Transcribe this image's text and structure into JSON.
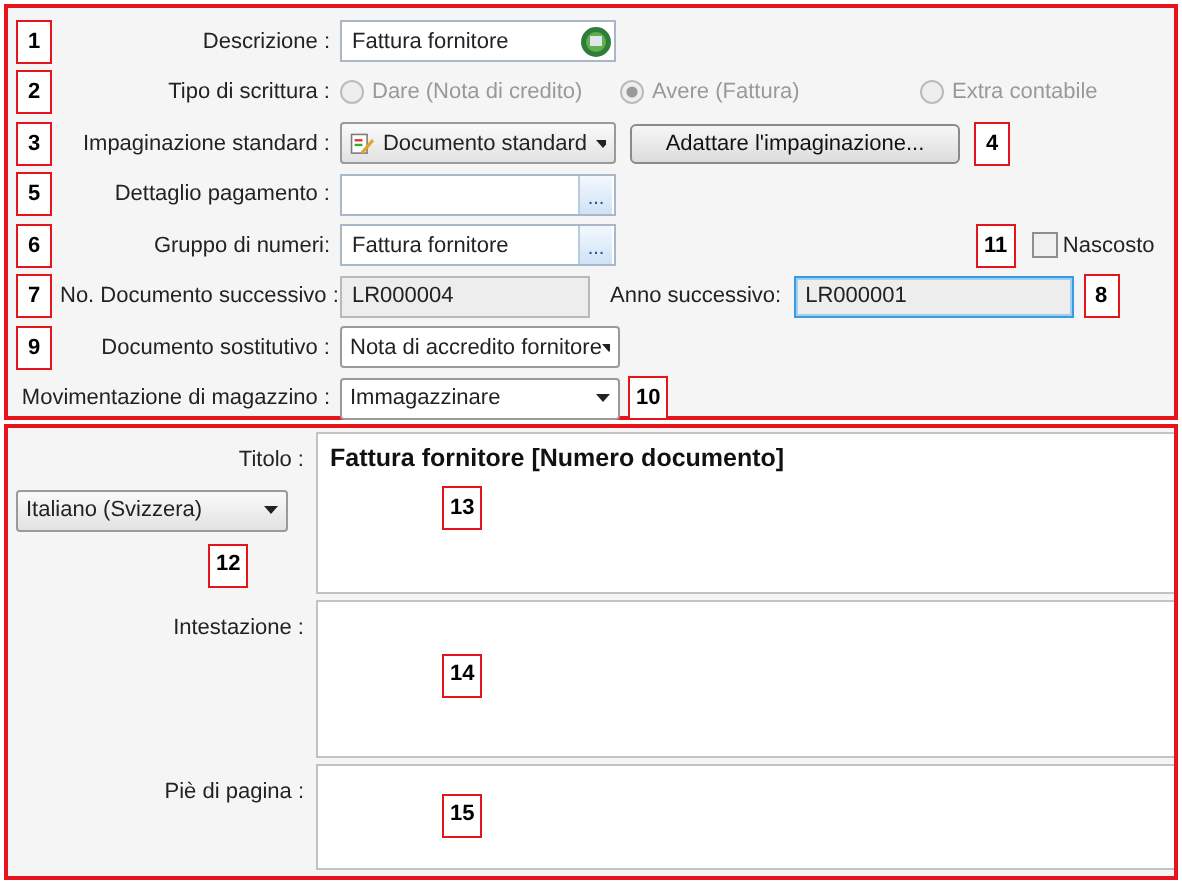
{
  "form": {
    "rows": [
      {
        "kind": "text_icon",
        "callout": "1",
        "label": "Descrizione :",
        "value": "Fattura fornitore"
      },
      {
        "kind": "radios",
        "callout": "2",
        "label": "Tipo di scrittura :",
        "disabled": true,
        "options": [
          {
            "label": "Dare (Nota di credito)",
            "selected": false
          },
          {
            "label": "Avere (Fattura)",
            "selected": true
          },
          {
            "label": "Extra contabile",
            "selected": false
          }
        ]
      },
      {
        "kind": "select_button",
        "callout": "3",
        "label": "Impaginazione standard :",
        "value": "Documento standard",
        "button": "Adattare l'impaginazione...",
        "button_callout": "4"
      },
      {
        "kind": "text_dots",
        "callout": "5",
        "label": "Dettaglio pagamento :",
        "dots": "..."
      },
      {
        "kind": "text_dots",
        "callout": "6",
        "label": "Gruppo di numeri:",
        "value": "Fattura fornitore",
        "dots": "...",
        "checkbox": {
          "callout": "11",
          "label": "Nascosto",
          "checked": false
        }
      },
      {
        "kind": "pair",
        "callout": "7",
        "label": "No. Documento successivo :",
        "value": "LR000004",
        "second_label": "Anno successivo:",
        "second_value": "LR000001",
        "second_callout": "8"
      },
      {
        "kind": "select",
        "callout": "9",
        "label": "Documento sostitutivo :",
        "value": "Nota di accredito fornitore"
      },
      {
        "kind": "select",
        "label": "Movimentazione di magazzino :",
        "value": "Immagazzinare",
        "after_callout": "10"
      }
    ]
  },
  "texts": {
    "language": "Italiano (Svizzera)",
    "language_callout": "12",
    "areas": [
      {
        "label": "Titolo :",
        "value": "Fattura fornitore [Numero documento]",
        "callout": "13"
      },
      {
        "label": "Intestazione :",
        "callout": "14"
      },
      {
        "label": "Piè di pagina :",
        "callout": "15"
      }
    ]
  }
}
